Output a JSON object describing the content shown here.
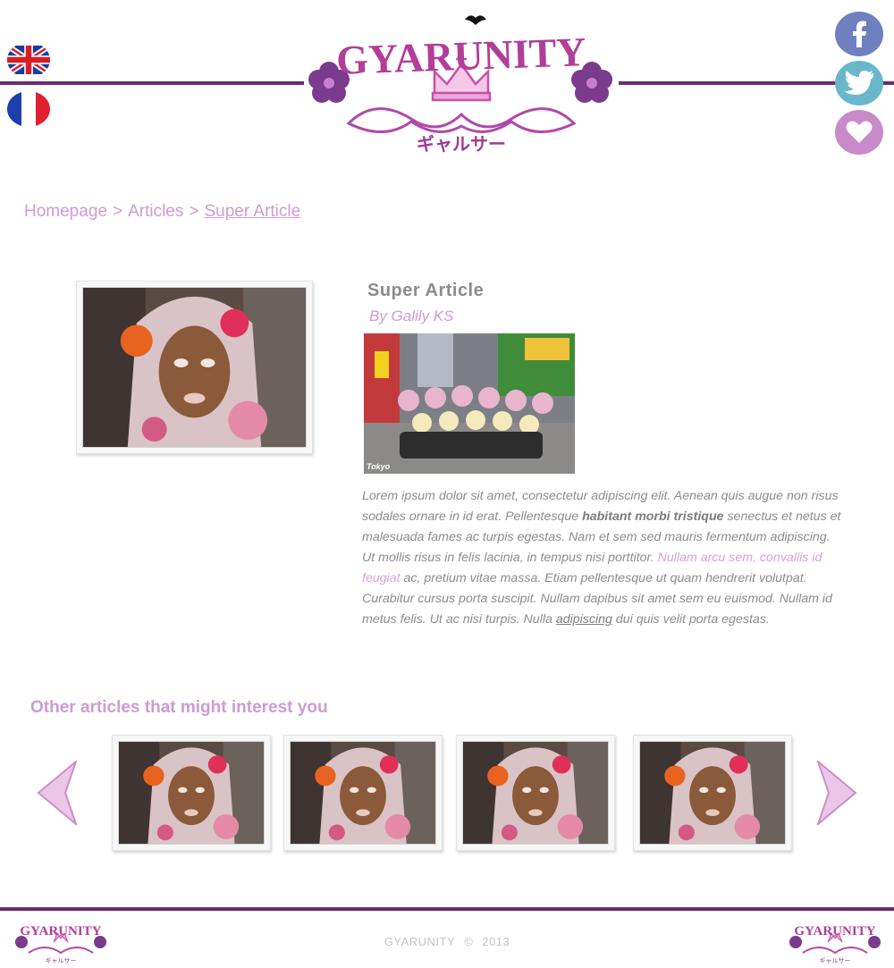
{
  "header": {
    "logo_text": "GYARUNITY",
    "logo_katakana": "ギャルサー",
    "languages": [
      {
        "name": "English"
      },
      {
        "name": "Français"
      }
    ],
    "social": [
      {
        "icon": "facebook-icon"
      },
      {
        "icon": "twitter-icon"
      },
      {
        "icon": "heart-icon"
      }
    ]
  },
  "breadcrumb": {
    "home": "Homepage",
    "separator": ">",
    "section": "Articles",
    "current": "Super Article"
  },
  "article": {
    "title": "Super Article",
    "author": "By Galily KS",
    "photo_watermark": "Tokyo",
    "body": {
      "p1": "Lorem ipsum dolor sit amet, consectetur adipiscing elit. Aenean quis augue non risus sodales ornare in id erat. Pellentesque ",
      "bold": "habitant morbi tristique",
      "p2": " senectus et netus et malesuada fames ac turpis egestas. Nam et sem sed mauris fermentum adipiscing. Ut mollis risus in felis lacinia, in tempus nisi porttitor. ",
      "link": "Nullam arcu sem, convallis id feugiat",
      "p3": " ac, pretium vitae massa. Etiam pellentesque ut quam hendrerit volutpat. Curabitur cursus porta suscipit. Nullam dapibus sit amet sem eu euismod. Nullam id metus felis. Ut ac nisi turpis. Nulla ",
      "underlined": "adipiscing",
      "p4": " dui quis velit porta egestas."
    }
  },
  "related": {
    "title": "Other articles that might interest you",
    "prev_icon": "chevron-left-icon",
    "next_icon": "chevron-right-icon",
    "count": 4
  },
  "footer": {
    "brand": "GYARUNITY",
    "copyright_symbol": "©",
    "year": "2013"
  },
  "colors": {
    "accent_purple": "#6a2c72",
    "pink": "#cf9bd1",
    "text_gray": "#8c8c8c"
  }
}
